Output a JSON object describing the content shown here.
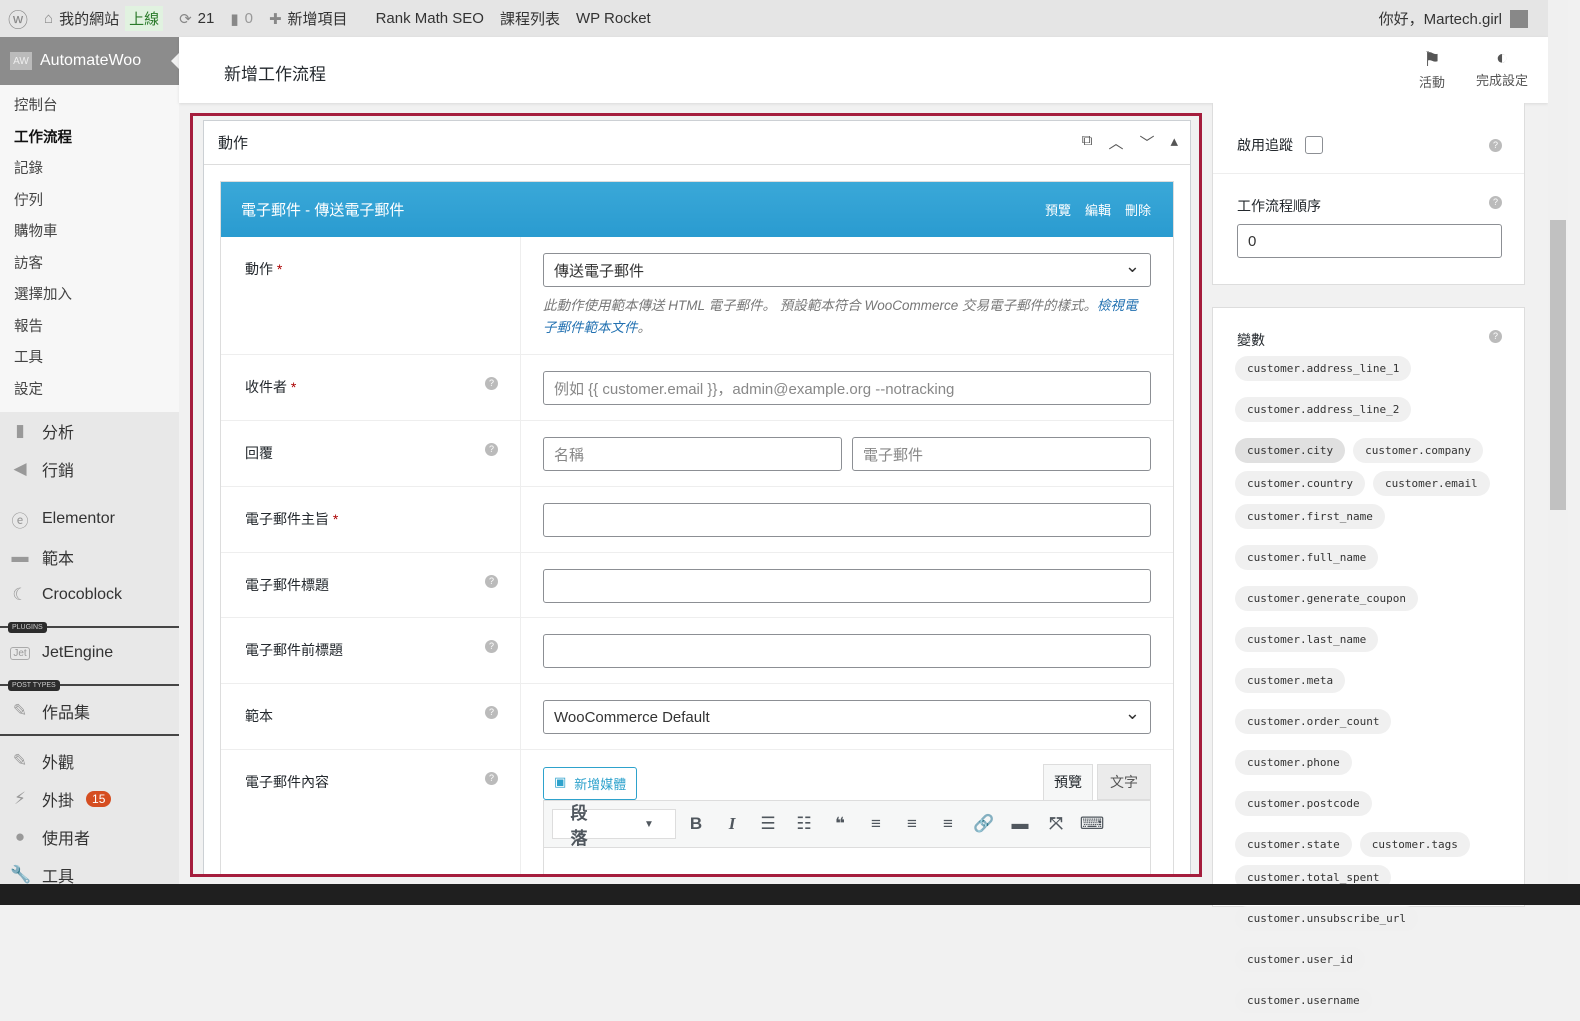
{
  "adminbar": {
    "site": "我的網站",
    "live": "上線",
    "updates": "21",
    "comments": "0",
    "new": "新增項目",
    "rankmath": "Rank Math SEO",
    "courses": "課程列表",
    "rocket": "WP Rocket",
    "greeting": "你好，Martech.girl"
  },
  "sidebar": {
    "plugin": "AutomateWoo",
    "sub": [
      "控制台",
      "工作流程",
      "記錄",
      "佇列",
      "購物車",
      "訪客",
      "選擇加入",
      "報告",
      "工具",
      "設定"
    ],
    "menu1": [
      "分析",
      "行銷"
    ],
    "elementor": "Elementor",
    "templates": "範本",
    "crocoblock": "Crocoblock",
    "plugins_label": "PLUGINS",
    "jetengine": "JetEngine",
    "post_types_label": "POST TYPES",
    "portfolio": "作品集",
    "appearance": "外觀",
    "plugins": "外掛",
    "plugins_badge": "15",
    "users": "使用者",
    "tools": "工具"
  },
  "header": {
    "title": "新增工作流程",
    "activity": "活動",
    "setup": "完成設定"
  },
  "box": {
    "title": "動作"
  },
  "action": {
    "title": "電子郵件 - 傳送電子郵件",
    "preview": "預覽",
    "edit": "編輯",
    "delete": "刪除",
    "fields": {
      "action_label": "動作",
      "action_value": "傳送電子郵件",
      "action_desc": "此動作使用範本傳送 HTML 電子郵件。 預設範本符合 WooCommerce 交易電子郵件的樣式。",
      "action_link": "檢視電子郵件範本文件",
      "action_desc_end": "。",
      "recipient_label": "收件者",
      "recipient_ph": "例如 {{ customer.email }}，admin@example.org --notracking",
      "reply_label": "回覆",
      "reply_name_ph": "名稱",
      "reply_email_ph": "電子郵件",
      "subject_label": "電子郵件主旨",
      "heading_label": "電子郵件標題",
      "preheader_label": "電子郵件前標題",
      "template_label": "範本",
      "template_value": "WooCommerce Default",
      "content_label": "電子郵件內容",
      "add_media": "新增媒體",
      "tab_visual": "預覽",
      "tab_text": "文字",
      "format": "段落"
    }
  },
  "right": {
    "tracking": "啟用追蹤",
    "order_label": "工作流程順序",
    "order_value": "0",
    "vars_label": "變數",
    "vars": [
      "customer.address_line_1",
      "customer.address_line_2",
      "customer.city",
      "customer.company",
      "customer.country",
      "customer.email",
      "customer.first_name",
      "customer.full_name",
      "customer.generate_coupon",
      "customer.last_name",
      "customer.meta",
      "customer.order_count",
      "customer.phone",
      "customer.postcode",
      "customer.state",
      "customer.tags",
      "customer.total_spent",
      "customer.unsubscribe_url",
      "customer.user_id",
      "customer.username"
    ]
  }
}
